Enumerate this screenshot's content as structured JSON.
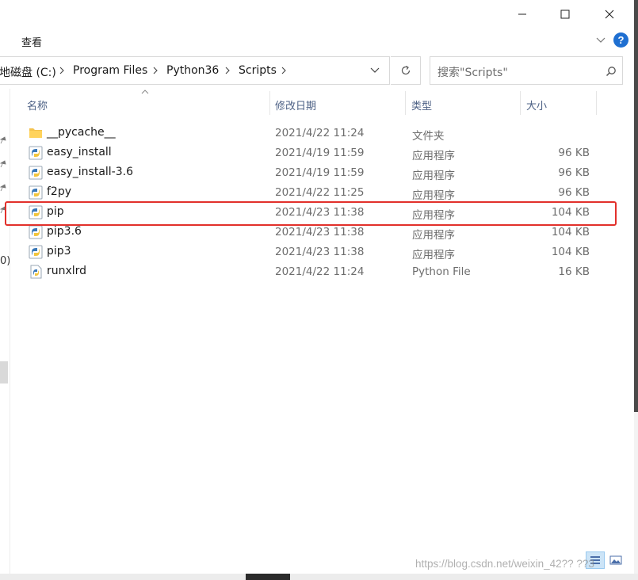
{
  "window": {
    "minimize_label": "minimize",
    "maximize_label": "maximize",
    "close_label": "close"
  },
  "ribbon": {
    "tab_view": "查看"
  },
  "address": {
    "crumbs": [
      "地磁盘 (C:)",
      "Program Files",
      "Python36",
      "Scripts"
    ]
  },
  "search": {
    "placeholder": "搜索\"Scripts\""
  },
  "nav": {
    "partial_text": "0)"
  },
  "columns": {
    "name": "名称",
    "date": "修改日期",
    "type": "类型",
    "size": "大小"
  },
  "files": [
    {
      "name": "__pycache__",
      "date": "2021/4/22 11:24",
      "type": "文件夹",
      "size": "",
      "icon": "folder-icon"
    },
    {
      "name": "easy_install",
      "date": "2021/4/19 11:59",
      "type": "应用程序",
      "size": "96 KB",
      "icon": "python-exe-icon"
    },
    {
      "name": "easy_install-3.6",
      "date": "2021/4/19 11:59",
      "type": "应用程序",
      "size": "96 KB",
      "icon": "python-exe-icon"
    },
    {
      "name": "f2py",
      "date": "2021/4/22 11:25",
      "type": "应用程序",
      "size": "96 KB",
      "icon": "python-exe-icon"
    },
    {
      "name": "pip",
      "date": "2021/4/23 11:38",
      "type": "应用程序",
      "size": "104 KB",
      "icon": "python-exe-icon",
      "highlighted": true
    },
    {
      "name": "pip3.6",
      "date": "2021/4/23 11:38",
      "type": "应用程序",
      "size": "104 KB",
      "icon": "python-exe-icon"
    },
    {
      "name": "pip3",
      "date": "2021/4/23 11:38",
      "type": "应用程序",
      "size": "104 KB",
      "icon": "python-exe-icon"
    },
    {
      "name": "runxlrd",
      "date": "2021/4/22 11:24",
      "type": "Python File",
      "size": "16 KB",
      "icon": "python-file-icon"
    }
  ],
  "watermark": "https://blog.csdn.net/weixin_42?? ??3",
  "colors": {
    "highlight_border": "#e2302b",
    "help_blue": "#1f6fd1",
    "header_text": "#4d6185",
    "selected_view": "#cce4f7"
  }
}
